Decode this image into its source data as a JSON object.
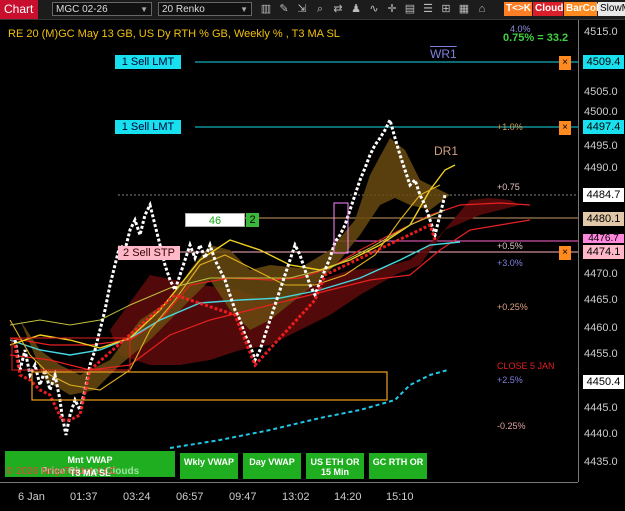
{
  "toolbar": {
    "chart_tab": "Chart",
    "instrument": "MGC 02-26",
    "bar_type": "20 Renko",
    "buttons": [
      "T<>K",
      "Cloud",
      "BarCol",
      "SlowM"
    ]
  },
  "header": {
    "title": "RE 20  (M)GC May 13 GB, US Dy RTH % GB, Weekly % , T3 MA SL",
    "top_pct": "4.0%",
    "ratio": "0.75% = 33.2"
  },
  "orders": [
    {
      "label": "1 Sell LMT",
      "price": "4509.4"
    },
    {
      "label": "1 Sell LMT",
      "price": "4497.4"
    },
    {
      "label": "2 Sell STP",
      "price": "4474.1"
    }
  ],
  "position": {
    "qty": "46",
    "count": "2"
  },
  "price_axis": {
    "ticks": [
      "4515.0",
      "4510.0",
      "4505.0",
      "4500.0",
      "4495.0",
      "4490.0",
      "4485.0",
      "4480.0",
      "4475.0",
      "4470.0",
      "4465.0",
      "4460.0",
      "4455.0",
      "4450.0",
      "4445.0",
      "4440.0",
      "4435.0"
    ],
    "last_price": "4484.7",
    "price_mid": "4480.1",
    "price_partial": "4476.7",
    "price_low": "4450.4"
  },
  "levels": {
    "wr1": "WR1",
    "dr1": "DR1",
    "p10": "+1.0%",
    "p075": "+0.75",
    "p05": "+0.5%",
    "p30": "+3.0%",
    "p025": "+0.25%",
    "close": "CLOSE 5 JAN",
    "p25": "+2.5%",
    "m025": "-0.25%"
  },
  "time_axis": [
    "6 Jan",
    "01:37",
    "03:24",
    "06:57",
    "09:47",
    "13:02",
    "14:20",
    "15:10"
  ],
  "vwap_buttons": [
    {
      "label": "Mnt VWAP"
    },
    {
      "label": "Wkly VWAP"
    },
    {
      "label": "Day VWAP"
    },
    {
      "label": "US ETH OR 15 Min"
    },
    {
      "label": "GC RTH OR"
    }
  ],
  "footer": {
    "copyright": "© 2026 NinjaTrader, LLC",
    "cloud_label": "Price Cluster Clouds",
    "t3_label": "T3 MA SL"
  },
  "colors": {
    "accent_red": "#c8102e",
    "order_cyan": "#18e0ee",
    "stop_pink": "#ffb0c0",
    "vwap_green": "#1fae1f"
  }
}
